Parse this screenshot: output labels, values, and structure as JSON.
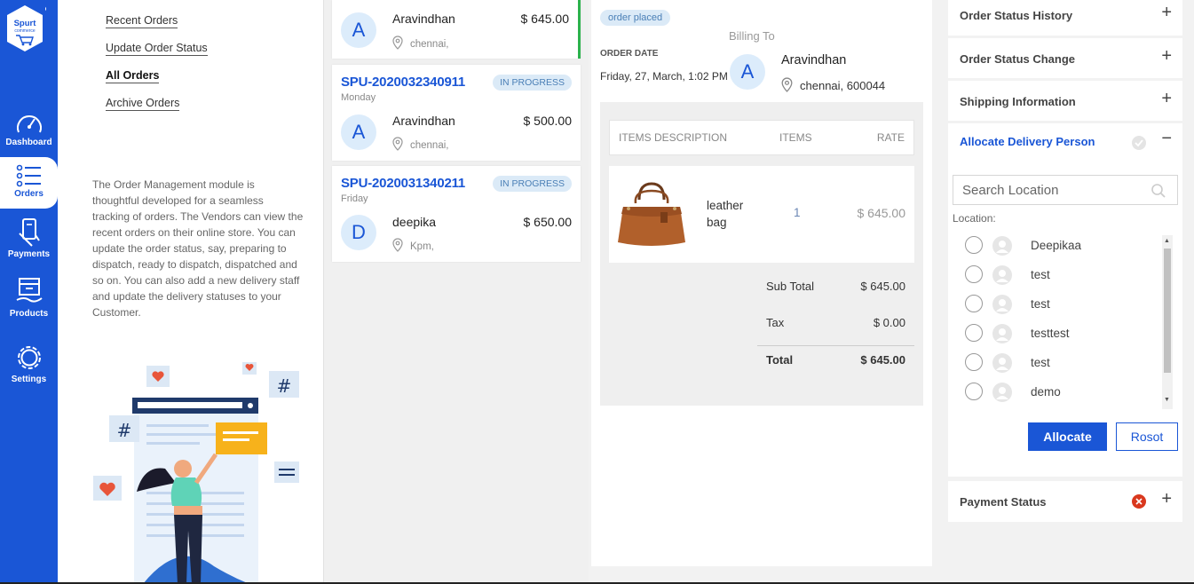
{
  "brand": {
    "name": "Spurt",
    "sub": "commerce"
  },
  "rail": [
    {
      "id": "dashboard",
      "label": "Dashboard"
    },
    {
      "id": "orders",
      "label": "Orders"
    },
    {
      "id": "payments",
      "label": "Payments"
    },
    {
      "id": "products",
      "label": "Products"
    },
    {
      "id": "settings",
      "label": "Settings"
    }
  ],
  "submenu": [
    "Recent Orders",
    "Update Order Status",
    "All Orders",
    "Archive Orders"
  ],
  "description": "The Order Management module is thoughtful developed for a seamless tracking of orders. The Vendors can view the recent orders on their online store. You can update the order status, say, preparing to dispatch, ready to dispatch, dispatched and so on. You can also add a new delivery staff and update the delivery statuses to your Customer.",
  "orders": [
    {
      "initial": "A",
      "name": "Aravindhan",
      "price": "$ 645.00",
      "location": "chennai,"
    },
    {
      "id": "SPU-2020032340911",
      "status": "IN PROGRESS",
      "day": "Monday",
      "initial": "A",
      "name": "Aravindhan",
      "price": "$ 500.00",
      "location": "chennai,"
    },
    {
      "id": "SPU-2020031340211",
      "status": "IN PROGRESS",
      "day": "Friday",
      "initial": "D",
      "name": "deepika",
      "price": "$ 650.00",
      "location": "Kpm,"
    }
  ],
  "detail": {
    "status": "order placed",
    "billing_to": "Billing To",
    "order_date_label": "ORDER DATE",
    "order_date": "Friday, 27, March, 1:02 PM",
    "bill_initial": "A",
    "bill_name": "Aravindhan",
    "bill_location": "chennai, 600044",
    "columns": [
      "ITEMS DESCRIPTION",
      "ITEMS",
      "RATE"
    ],
    "item": {
      "name": "leather bag",
      "qty": "1",
      "rate": "$ 645.00"
    },
    "subtotal_label": "Sub Total",
    "subtotal": "$ 645.00",
    "tax_label": "Tax",
    "tax": "$ 0.00",
    "total_label": "Total",
    "total": "$ 645.00"
  },
  "side": {
    "history": "Order Status History",
    "change": "Order Status Change",
    "shipping": "Shipping Information",
    "delivery": "Allocate Delivery Person",
    "search_placeholder": "Search Location",
    "location_label": "Location:",
    "persons": [
      "Deepikaa",
      "test",
      "test",
      "testtest",
      "test",
      "demo"
    ],
    "allocate": "Allocate",
    "reset": "Rosot",
    "payment": "Payment Status"
  },
  "colors": {
    "accent": "#1a56d6",
    "active_bar": "#2bb24c",
    "badge_bg": "#dbeaf7",
    "error": "#d9381e"
  }
}
